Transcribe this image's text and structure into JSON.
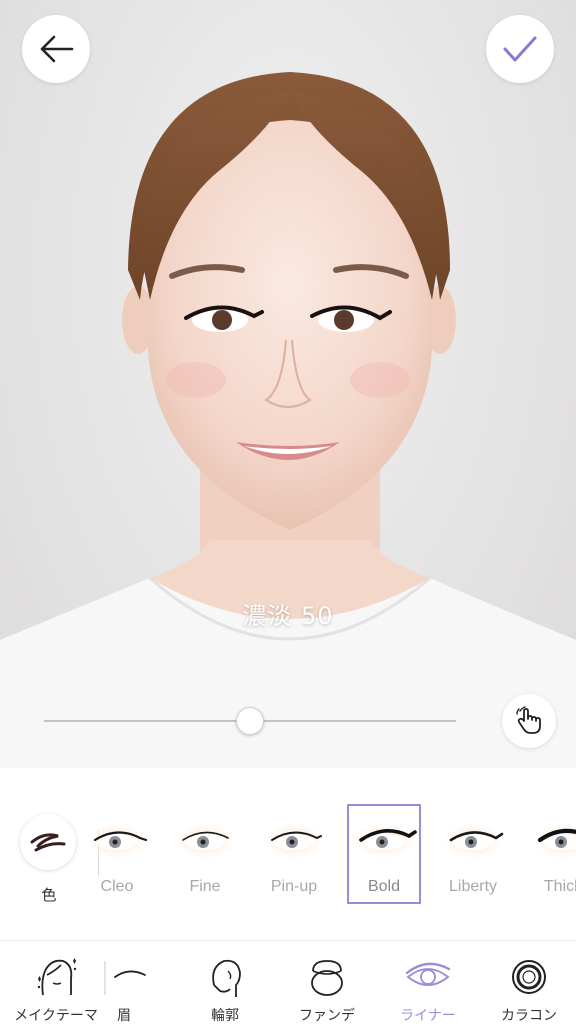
{
  "header": {
    "back_icon": "arrow-left-icon",
    "done_icon": "checkmark-icon",
    "accent_color": "#8a78d6"
  },
  "intensity": {
    "label": "濃淡 50",
    "value": 50,
    "max": 100
  },
  "compare_icon": "tap-hand-icon",
  "color_picker": {
    "label": "色",
    "swatch_color": "#3a1f1c"
  },
  "liner_styles": [
    {
      "label": "Cleo",
      "selected": false
    },
    {
      "label": "Fine",
      "selected": false
    },
    {
      "label": "Pin-up",
      "selected": false
    },
    {
      "label": "Bold",
      "selected": true
    },
    {
      "label": "Liberty",
      "selected": false
    },
    {
      "label": "Thick",
      "selected": false
    }
  ],
  "categories": [
    {
      "label": "メイクテーマ",
      "icon": "face-theme-icon",
      "active": false
    },
    {
      "label": "眉",
      "icon": "eyebrow-icon",
      "active": false
    },
    {
      "label": "輪郭",
      "icon": "face-contour-icon",
      "active": false
    },
    {
      "label": "ファンデ",
      "icon": "compact-icon",
      "active": false
    },
    {
      "label": "ライナー",
      "icon": "eye-liner-icon",
      "active": true
    },
    {
      "label": "カラコン",
      "icon": "contact-lens-icon",
      "active": false
    }
  ]
}
